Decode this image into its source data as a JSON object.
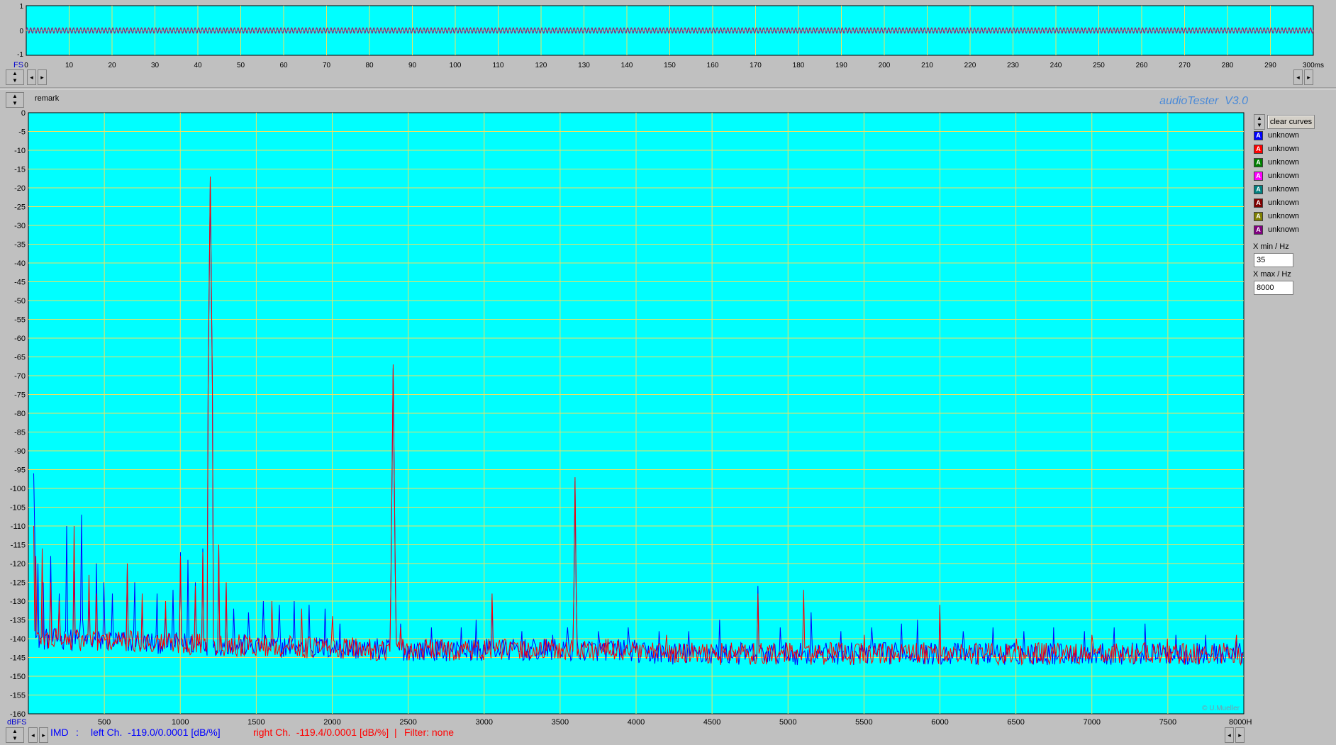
{
  "app": {
    "title": "audioTester  V3.0",
    "copyright": "© U.Mueller",
    "remark_label": "remark"
  },
  "oscilloscope": {
    "fs_label": "FS",
    "y_ticks": [
      "1",
      "0",
      "-1"
    ],
    "x_ticks": [
      "0",
      "10",
      "20",
      "30",
      "40",
      "50",
      "60",
      "70",
      "80",
      "90",
      "100",
      "110",
      "120",
      "130",
      "140",
      "150",
      "160",
      "170",
      "180",
      "190",
      "200",
      "210",
      "220",
      "230",
      "240",
      "250",
      "260",
      "270",
      "280",
      "290",
      "300ms"
    ],
    "x_max_ms": 300
  },
  "colors": {
    "plot_bg": "#00ffff",
    "grid": "#f0e060",
    "left_channel": "#0000ff",
    "right_channel": "#ff0000",
    "axis_text": "#000000"
  },
  "curves_panel": {
    "clear_label": "clear curves",
    "items": [
      {
        "letter": "A",
        "color": "#0000ff",
        "label": "unknown"
      },
      {
        "letter": "A",
        "color": "#ff0000",
        "label": "unknown"
      },
      {
        "letter": "A",
        "color": "#008000",
        "label": "unknown"
      },
      {
        "letter": "A",
        "color": "#ff00ff",
        "label": "unknown"
      },
      {
        "letter": "A",
        "color": "#008080",
        "label": "unknown"
      },
      {
        "letter": "A",
        "color": "#800000",
        "label": "unknown"
      },
      {
        "letter": "A",
        "color": "#808000",
        "label": "unknown"
      },
      {
        "letter": "A",
        "color": "#800080",
        "label": "unknown"
      }
    ],
    "xmin_label": "X min / Hz",
    "xmin_value": "35",
    "xmax_label": "X max / Hz",
    "xmax_value": "8000"
  },
  "status": {
    "mode": "IMD",
    "colon": ":",
    "left": "left Ch.  -119.0/0.0001 [dB/%]",
    "right": "right Ch.  -119.4/0.0001 [dB/%]  |",
    "filter": "Filter: none"
  },
  "chart_data": {
    "type": "line",
    "xlabel": "",
    "ylabel": "",
    "x_unit_label": "8000H",
    "y_unit_label": "dBFS",
    "xlim": [
      0,
      8000
    ],
    "ylim": [
      -160,
      0
    ],
    "x_ticks": [
      "500",
      "1000",
      "1500",
      "2000",
      "2500",
      "3000",
      "3500",
      "4000",
      "4500",
      "5000",
      "5500",
      "6000",
      "6500",
      "7000",
      "7500"
    ],
    "y_ticks": [
      "0",
      "-5",
      "-10",
      "-15",
      "-20",
      "-25",
      "-30",
      "-35",
      "-40",
      "-45",
      "-50",
      "-55",
      "-60",
      "-65",
      "-70",
      "-75",
      "-80",
      "-85",
      "-90",
      "-95",
      "-100",
      "-105",
      "-110",
      "-115",
      "-120",
      "-125",
      "-130",
      "-135",
      "-140",
      "-145",
      "-150",
      "-155",
      "-160"
    ],
    "noise_floor_db": -143,
    "grid": true,
    "series": [
      {
        "name": "left Ch.",
        "color": "#0000ff",
        "peaks": [
          {
            "x": 35,
            "y": -96
          },
          {
            "x": 40,
            "y": -112
          },
          {
            "x": 60,
            "y": -120
          },
          {
            "x": 100,
            "y": -125
          },
          {
            "x": 150,
            "y": -118
          },
          {
            "x": 200,
            "y": -128
          },
          {
            "x": 250,
            "y": -110
          },
          {
            "x": 300,
            "y": -122
          },
          {
            "x": 350,
            "y": -107
          },
          {
            "x": 400,
            "y": -130
          },
          {
            "x": 450,
            "y": -120
          },
          {
            "x": 500,
            "y": -125
          },
          {
            "x": 550,
            "y": -128
          },
          {
            "x": 650,
            "y": -121
          },
          {
            "x": 700,
            "y": -125
          },
          {
            "x": 750,
            "y": -130
          },
          {
            "x": 850,
            "y": -128
          },
          {
            "x": 900,
            "y": -132
          },
          {
            "x": 950,
            "y": -127
          },
          {
            "x": 1000,
            "y": -117
          },
          {
            "x": 1050,
            "y": -119
          },
          {
            "x": 1100,
            "y": -125
          },
          {
            "x": 1150,
            "y": -116
          },
          {
            "x": 1200,
            "y": -18
          },
          {
            "x": 1250,
            "y": -116
          },
          {
            "x": 1300,
            "y": -126
          },
          {
            "x": 1350,
            "y": -132
          },
          {
            "x": 1450,
            "y": -133
          },
          {
            "x": 1550,
            "y": -130
          },
          {
            "x": 1650,
            "y": -131
          },
          {
            "x": 1750,
            "y": -130
          },
          {
            "x": 1850,
            "y": -131
          },
          {
            "x": 1950,
            "y": -132
          },
          {
            "x": 2050,
            "y": -136
          },
          {
            "x": 2400,
            "y": -68
          },
          {
            "x": 2450,
            "y": -136
          },
          {
            "x": 2650,
            "y": -137
          },
          {
            "x": 2850,
            "y": -137
          },
          {
            "x": 2950,
            "y": -135
          },
          {
            "x": 3050,
            "y": -129
          },
          {
            "x": 3250,
            "y": -138
          },
          {
            "x": 3450,
            "y": -139
          },
          {
            "x": 3550,
            "y": -137
          },
          {
            "x": 3600,
            "y": -98
          },
          {
            "x": 3750,
            "y": -138
          },
          {
            "x": 3950,
            "y": -137
          },
          {
            "x": 4150,
            "y": -138
          },
          {
            "x": 4350,
            "y": -138
          },
          {
            "x": 4550,
            "y": -135
          },
          {
            "x": 4800,
            "y": -126
          },
          {
            "x": 4950,
            "y": -137
          },
          {
            "x": 5150,
            "y": -133
          },
          {
            "x": 5350,
            "y": -138
          },
          {
            "x": 5550,
            "y": -137
          },
          {
            "x": 5750,
            "y": -136
          },
          {
            "x": 5850,
            "y": -135
          },
          {
            "x": 6000,
            "y": -133
          },
          {
            "x": 6150,
            "y": -138
          },
          {
            "x": 6350,
            "y": -137
          },
          {
            "x": 6550,
            "y": -138
          },
          {
            "x": 6750,
            "y": -137
          },
          {
            "x": 6950,
            "y": -138
          },
          {
            "x": 7150,
            "y": -137
          },
          {
            "x": 7350,
            "y": -136
          },
          {
            "x": 7550,
            "y": -139
          },
          {
            "x": 7750,
            "y": -139
          },
          {
            "x": 7950,
            "y": -140
          }
        ]
      },
      {
        "name": "right Ch.",
        "color": "#ff0000",
        "peaks": [
          {
            "x": 35,
            "y": -110
          },
          {
            "x": 50,
            "y": -118
          },
          {
            "x": 90,
            "y": -116
          },
          {
            "x": 150,
            "y": -125
          },
          {
            "x": 200,
            "y": -130
          },
          {
            "x": 300,
            "y": -110
          },
          {
            "x": 400,
            "y": -123
          },
          {
            "x": 450,
            "y": -128
          },
          {
            "x": 650,
            "y": -120
          },
          {
            "x": 750,
            "y": -128
          },
          {
            "x": 900,
            "y": -130
          },
          {
            "x": 1000,
            "y": -118
          },
          {
            "x": 1100,
            "y": -126
          },
          {
            "x": 1150,
            "y": -117
          },
          {
            "x": 1200,
            "y": -17
          },
          {
            "x": 1250,
            "y": -115
          },
          {
            "x": 1300,
            "y": -125
          },
          {
            "x": 1600,
            "y": -130
          },
          {
            "x": 1800,
            "y": -132
          },
          {
            "x": 2000,
            "y": -134
          },
          {
            "x": 2400,
            "y": -67
          },
          {
            "x": 2450,
            "y": -137
          },
          {
            "x": 3050,
            "y": -128
          },
          {
            "x": 3600,
            "y": -97
          },
          {
            "x": 4200,
            "y": -139
          },
          {
            "x": 4800,
            "y": -128
          },
          {
            "x": 5100,
            "y": -127
          },
          {
            "x": 5500,
            "y": -139
          },
          {
            "x": 6000,
            "y": -131
          },
          {
            "x": 6500,
            "y": -140
          },
          {
            "x": 7000,
            "y": -139
          },
          {
            "x": 7500,
            "y": -140
          },
          {
            "x": 7950,
            "y": -139
          }
        ]
      }
    ]
  }
}
